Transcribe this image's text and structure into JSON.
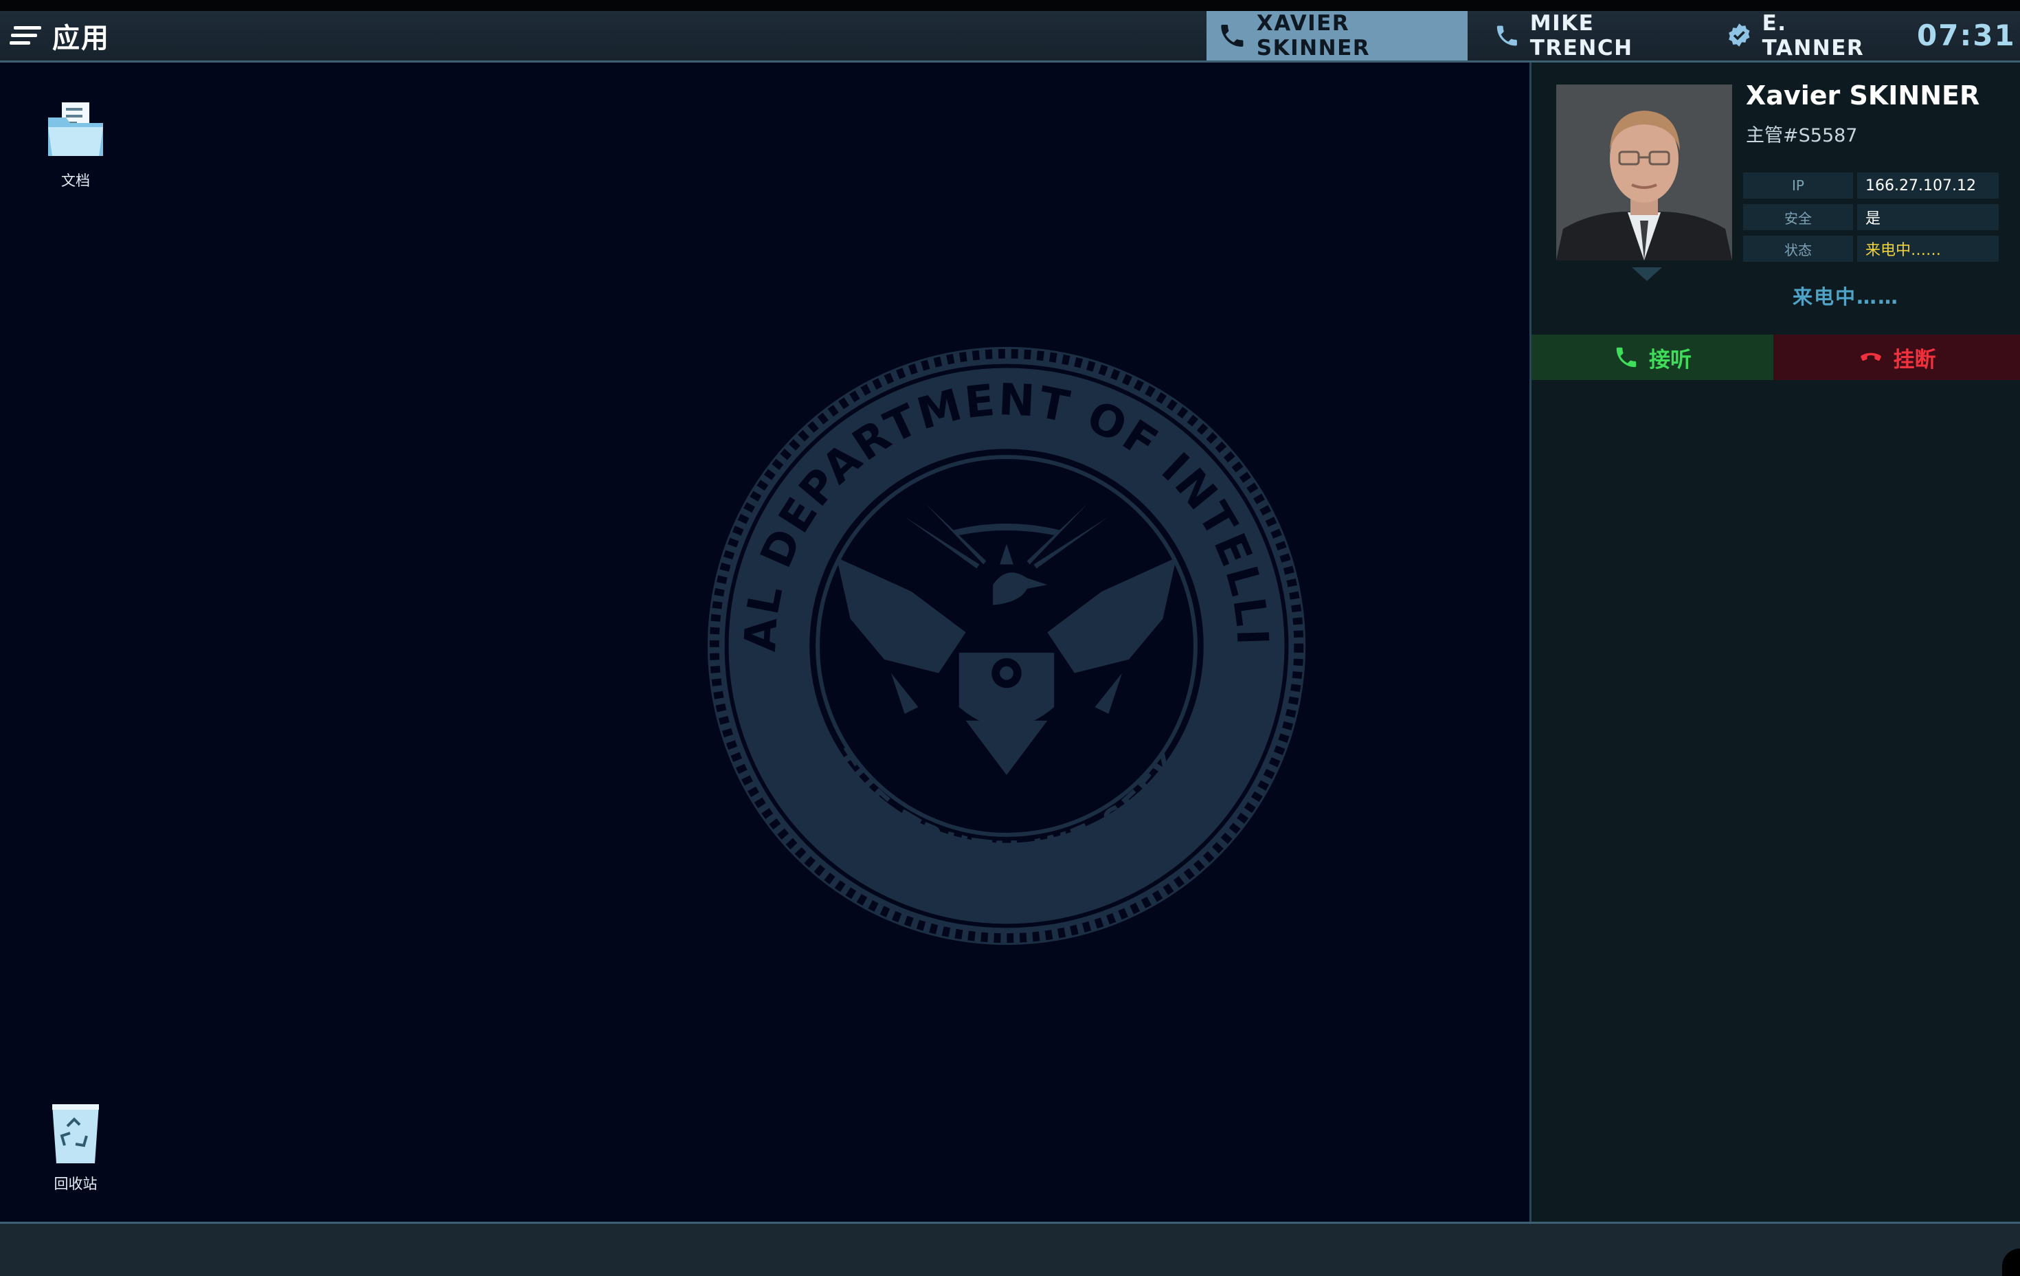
{
  "menu": {
    "label": "应用",
    "icon": "hamburger-icon"
  },
  "tabs": [
    {
      "label": "XAVIER SKINNER",
      "icon": "phone-icon",
      "active": true
    },
    {
      "label": "MIKE TRENCH",
      "icon": "phone-icon",
      "active": false
    },
    {
      "label": "E. TANNER",
      "icon": "verified-badge-icon",
      "active": false
    }
  ],
  "clock": "07:31",
  "desktop": {
    "icons": [
      {
        "label": "文档",
        "icon": "folder-icon"
      },
      {
        "label": "回收站",
        "icon": "recycle-bin-icon"
      }
    ],
    "seal": {
      "top_text": "FEDERAL DEPARTMENT OF INTELLIGENCE",
      "bottom_text": "THE TRUTH WE SEEK"
    }
  },
  "caller": {
    "name": "Xavier SKINNER",
    "subtitle": "主管#S5587",
    "info": [
      {
        "key": "IP",
        "value": "166.27.107.12"
      },
      {
        "key": "安全",
        "value": "是"
      },
      {
        "key": "状态",
        "value": "来电中……"
      }
    ],
    "status_text": "来电中……",
    "accept_label": "接听",
    "decline_label": "挂断"
  },
  "colors": {
    "accent": "#6f99b4",
    "accept": "#3ede5a",
    "decline": "#f0323f",
    "warning": "#f0d33a",
    "desktop_bg": "#02061a"
  }
}
